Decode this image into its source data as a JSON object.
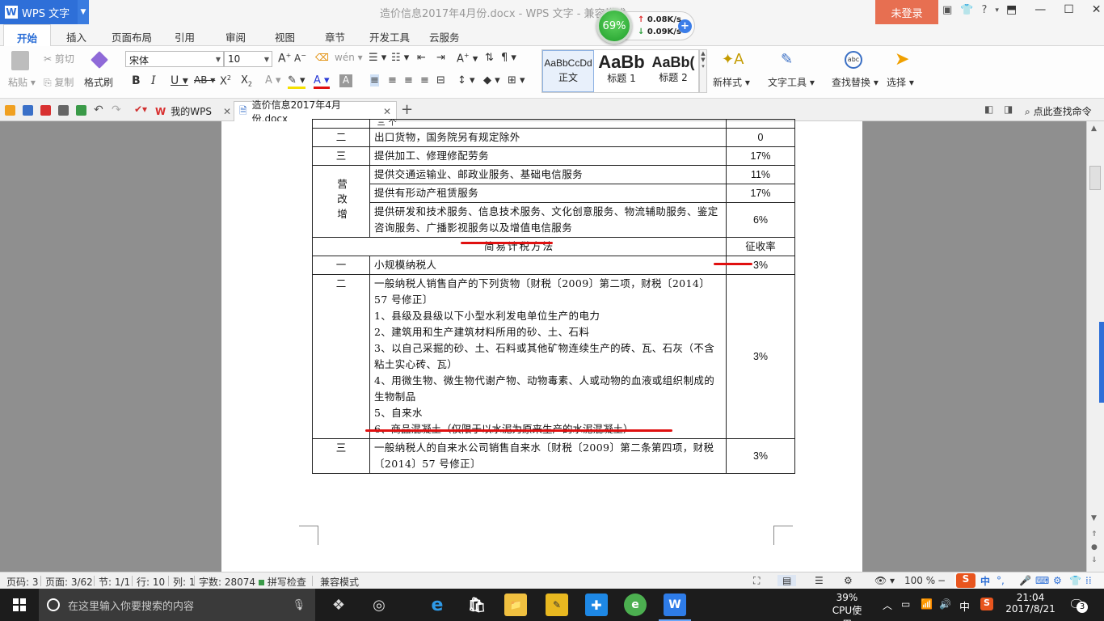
{
  "titlebar": {
    "app_name": "WPS 文字",
    "window_title": "造价信息2017年4月份.docx - WPS 文字 - 兼容模式",
    "login_label": "未登录",
    "gauge_value": "69%",
    "net_up": "0.08K/s",
    "net_down": "0.09K/s"
  },
  "menu": {
    "tabs": [
      "开始",
      "插入",
      "页面布局",
      "引用",
      "审阅",
      "视图",
      "章节",
      "开发工具",
      "云服务"
    ]
  },
  "ribbon": {
    "paste": "粘贴",
    "cut": "剪切",
    "copy": "复制",
    "format_painter": "格式刷",
    "font_name": "宋体",
    "font_size": "10",
    "styles": [
      {
        "sample": "AaBbCcDd",
        "name": "正文"
      },
      {
        "sample": "AaBb",
        "name": "标题 1"
      },
      {
        "sample": "AaBb(",
        "name": "标题 2"
      }
    ],
    "new_style": "新样式",
    "text_tools": "文字工具",
    "find_replace": "查找替换",
    "select": "选择"
  },
  "tabbar": {
    "my_wps": "我的WPS",
    "doc_tab": "造价信息2017年4月份.docx",
    "search_cmd": "点此查找命令"
  },
  "table": {
    "top_partial": "三 个",
    "rows": [
      {
        "num": "二",
        "desc": "出口货物，国务院另有规定除外",
        "rate": "0"
      },
      {
        "num": "三",
        "desc": "提供加工、修理修配劳务",
        "rate": "17%"
      },
      {
        "num": "营改增",
        "desc": "提供交通运输业、邮政业服务、基础电信服务",
        "rate": "11%"
      },
      {
        "num": "",
        "desc": "提供有形动产租赁服务",
        "rate": "17%"
      },
      {
        "num": "",
        "desc": "提供研发和技术服务、信息技术服务、文化创意服务、物流辅助服务、鉴定咨询服务、广播影视服务以及增值电信服务",
        "rate": "6%"
      },
      {
        "num": "",
        "desc": "简易计税方法",
        "rate": "征收率"
      },
      {
        "num": "一",
        "desc": "小规模纳税人",
        "rate": "3%"
      },
      {
        "num": "二",
        "desc_lines": [
          "一般纳税人销售自产的下列货物〔财税〔2009〕第二项，财税〔2014〕57 号修正〕",
          "1、县级及县级以下小型水利发电单位生产的电力",
          "2、建筑用和生产建筑材料所用的砂、土、石料",
          "3、以自己采掘的砂、土、石料或其他矿物连续生产的砖、瓦、石灰（不含粘土实心砖、瓦）",
          "4、用微生物、微生物代谢产物、动物毒素、人或动物的血液或组织制成的生物制品",
          "5、自来水",
          "6、商品混凝土（仅限于以水泥为原来生产的水泥混凝土）"
        ],
        "rate": "3%"
      },
      {
        "num": "三",
        "desc": "一般纳税人的自来水公司销售自来水〔财税〔2009〕第二条第四项，财税〔2014〕57 号修正〕",
        "rate": "3%"
      }
    ]
  },
  "status": {
    "page_code": "页码: 3",
    "page": "页面: 3/62",
    "section": "节: 1/1",
    "row": "行: 10",
    "col": "列: 1",
    "word_count": "字数: 28074",
    "spell_check": "拼写检查",
    "compat": "兼容模式",
    "zoom": "100 %"
  },
  "taskbar": {
    "search_placeholder": "在这里输入你要搜索的内容",
    "cpu_percent": "39%",
    "cpu_label": "CPU使用",
    "ime": "中",
    "time": "21:04",
    "date": "2017/8/21",
    "notif_count": "3"
  }
}
